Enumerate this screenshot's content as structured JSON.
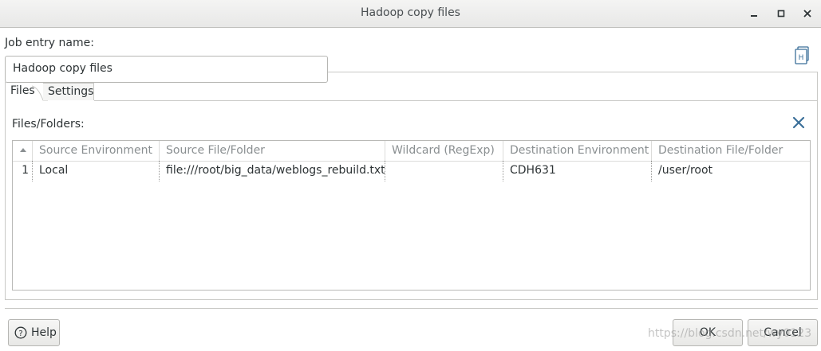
{
  "window": {
    "title": "Hadoop copy files"
  },
  "entry": {
    "label": "Job entry name:",
    "value": "Hadoop copy files"
  },
  "tabs": [
    {
      "label": "Files"
    },
    {
      "label": "Settings"
    }
  ],
  "files_section": {
    "label": "Files/Folders:",
    "columns": [
      "Source Environment",
      "Source File/Folder",
      "Wildcard (RegExp)",
      "Destination Environment",
      "Destination File/Folder"
    ],
    "rows": [
      {
        "num": "1",
        "source_env": "Local",
        "source_path": "file:///root/big_data/weblogs_rebuild.txt",
        "wildcard": "",
        "dest_env": "CDH631",
        "dest_path": "/user/root"
      }
    ]
  },
  "buttons": {
    "help": "Help",
    "ok": "OK",
    "cancel": "Cancel"
  },
  "watermark": "https://blog.csdn.net/wy0123",
  "icons": {
    "minimize": "minimize-icon",
    "maximize": "maximize-icon",
    "close": "close-icon",
    "hop": "hop-document-icon",
    "delete": "delete-x-icon",
    "help": "help-icon"
  },
  "colors": {
    "accent_icon": "#3b6f99",
    "text": "#2e3436",
    "header_text": "#8a8f91"
  }
}
